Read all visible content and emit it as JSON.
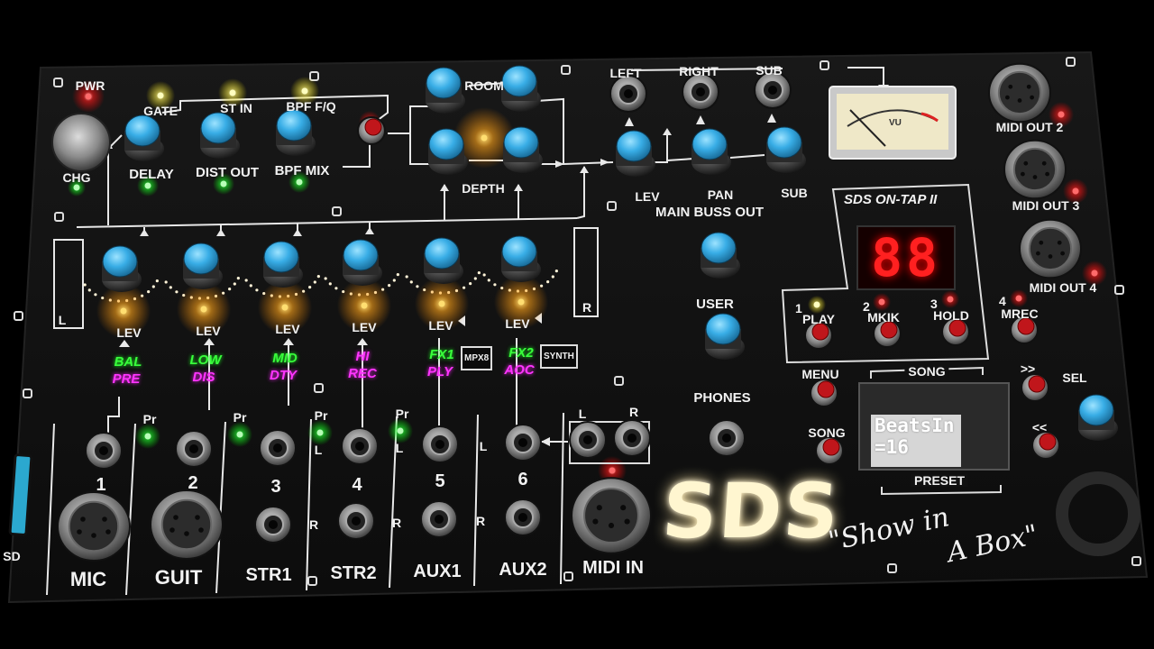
{
  "colors": {
    "panel": "#111111",
    "knob": "#3ab0e6",
    "led_green": "#2fff3a",
    "led_red": "#ff2222",
    "led_amber": "#ffb21a",
    "seven_segment": "#ff2020"
  },
  "top": {
    "pwr": "PWR",
    "chg": "CHG",
    "gate": "GATE",
    "st_in": "ST IN",
    "bpf_fq": "BPF F/Q",
    "delay": "DELAY",
    "dist_out": "DIST OUT",
    "bpf_mix": "BPF MIX",
    "room": "ROOM",
    "depth": "DEPTH",
    "lev": "LEV",
    "pan": "PAN",
    "sub": "SUB",
    "main_buss_out": "MAIN BUSS OUT",
    "left": "LEFT",
    "right": "RIGHT",
    "sub_out": "SUB",
    "vu": "VU"
  },
  "meters": {
    "left": "L",
    "right": "R"
  },
  "channels": [
    {
      "lev": "LEV",
      "green": "BAL",
      "magenta": "PRE",
      "num": "1",
      "name": "MIC"
    },
    {
      "lev": "LEV",
      "green": "LOW",
      "magenta": "DIS",
      "num": "2",
      "name": "GUIT"
    },
    {
      "lev": "LEV",
      "green": "MID",
      "magenta": "DTY",
      "num": "3",
      "name": "STR1"
    },
    {
      "lev": "LEV",
      "green": "",
      "magenta": "HI",
      "num": "4",
      "name": "STR2"
    },
    {
      "lev": "LEV",
      "green": "FX1",
      "magenta": "PLY",
      "num": "5",
      "name": "AUX1"
    },
    {
      "lev": "LEV",
      "green": "FX2",
      "magenta": "AOC",
      "num": "6",
      "name": "AUX2"
    }
  ],
  "channel4_extra": "REC",
  "pr": "Pr",
  "lr": {
    "l": "L",
    "r": "R"
  },
  "tags": {
    "mpx8": "MPX8",
    "synth": "SYNTH"
  },
  "midi": {
    "in": "MIDI IN",
    "l": "L",
    "r": "R",
    "out2": "MIDI OUT 2",
    "out3": "MIDI OUT 3",
    "out4": "MIDI OUT 4"
  },
  "user": "USER",
  "phones": "PHONES",
  "ontap": {
    "title": "SDS ON-TAP II",
    "display": "88",
    "play": "PLAY",
    "mkik": "MKIK",
    "hold": "HOLD",
    "mrec": "MREC",
    "n1": "1",
    "n2": "2",
    "n3": "3",
    "n4": "4"
  },
  "controls": {
    "menu": "MENU",
    "song_btn": "SONG",
    "song_label": "SONG",
    "preset": "PRESET",
    "ff": ">>",
    "rew": "<<",
    "sel": "SEL"
  },
  "lcd": {
    "line1": "BeatsIn",
    "line2": "=16"
  },
  "sd": "SD",
  "brand": {
    "logo": "SDS",
    "tagline1": "\"Show in",
    "tagline2": "A Box\""
  }
}
